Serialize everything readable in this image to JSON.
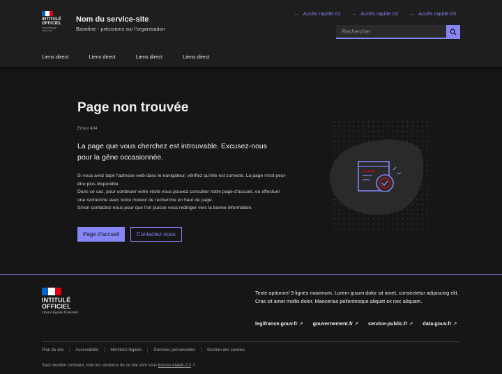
{
  "colors": {
    "accent": "#8585f6",
    "flag_blue": "#0063cb",
    "flag_white": "#ffffff",
    "flag_red": "#e1000f"
  },
  "header": {
    "logo_title": "INTITULÉ OFFICIEL",
    "logo_motto": "Liberté Égalité Fraternité",
    "service_title": "Nom du service-site",
    "service_tagline": "Baseline - précisions sur l'organisation",
    "quick_links": [
      "Accès rapide 01",
      "Accès rapide 02",
      "Accès rapide 03"
    ],
    "search_placeholder": "Rechercher",
    "nav": [
      "Liens direct",
      "Liens direct",
      "Liens direct",
      "Liens direct"
    ]
  },
  "main": {
    "title": "Page non trouvée",
    "error_code": "Erreur 404",
    "lead": "La page que vous cherchez est introuvable. Excusez-nous pour la gêne occasionnée.",
    "body_lines": [
      "Si vous avez tapé l'adresse web dans le navigateur, vérifiez qu'elle  est correcte. La page n'est peut-être plus disponible.",
      "Dans ce cas, pour continuer votre visite vous pouvez consulter notre page d'accueil, ou effectuer une recherche avec notre moteur de recherche en haut de page.",
      "Sinon contactez-nous pour que l'on puisse vous rediriger vers la bonne information."
    ],
    "primary_button": "Page d'accueil",
    "secondary_button": "Contactez-nous"
  },
  "footer": {
    "logo_title": "INTITULÉ OFFICIEL",
    "logo_motto": "Liberté Égalité Fraternité",
    "description": "Texte optionnel 3 lignes maximum. Lorem ipsum dolor sit amet, consectetur adipiscing elit. Cras sit amet mollis dolor. Maecenas pellentesque aliquet ex nec aliquam.",
    "links": [
      "legifrance.gouv.fr",
      "gouvernement.fr",
      "service-public.fr",
      "data.gouv.fr"
    ],
    "bottom_links": [
      "Plan du site",
      "Accessibilité",
      "Mentions légales",
      "Données personnelles",
      "Gestion des cookies"
    ],
    "license_text": "Sauf mention contraire, tous les contenus de ce site sont sous",
    "license_link": "licence etalab-2.0"
  }
}
